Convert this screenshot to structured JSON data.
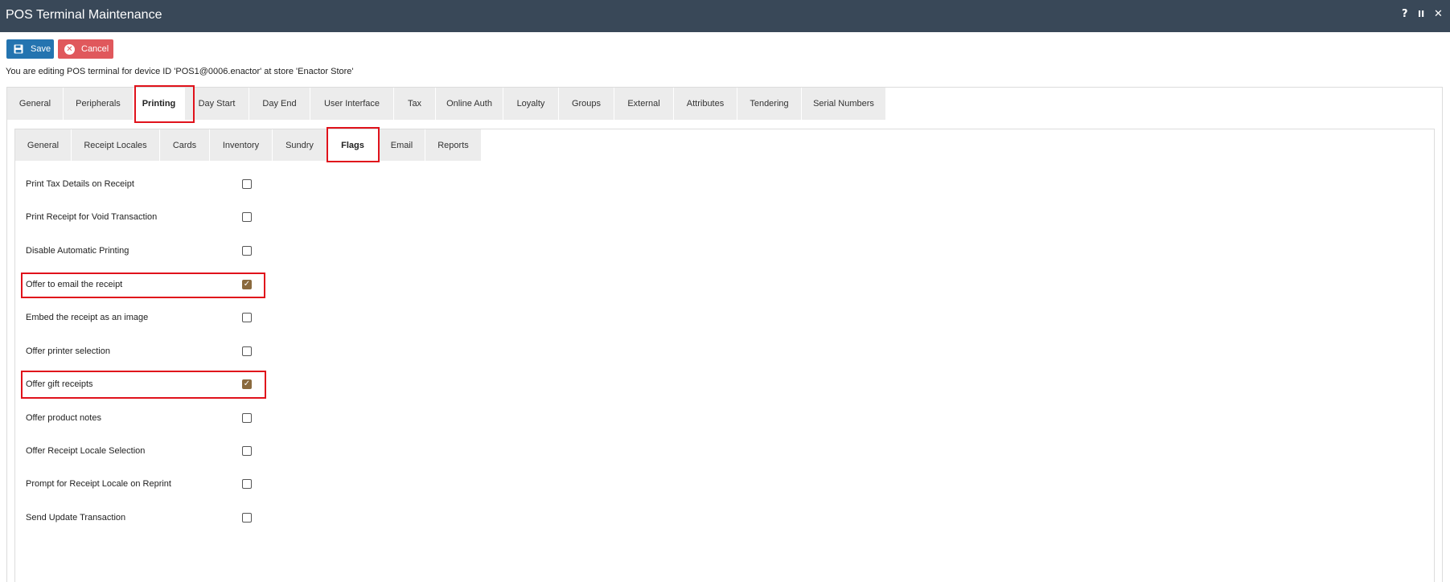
{
  "window": {
    "title": "POS Terminal Maintenance",
    "controls": {
      "help": "?",
      "pause": "II",
      "close": "✕"
    }
  },
  "toolbar": {
    "save_label": "Save",
    "cancel_label": "Cancel"
  },
  "info_text": "You are editing POS terminal for device ID 'POS1@0006.enactor' at store 'Enactor Store'",
  "main_tabs": [
    {
      "label": "General"
    },
    {
      "label": "Peripherals"
    },
    {
      "label": "Printing",
      "active": true
    },
    {
      "label": "Day Start"
    },
    {
      "label": "Day End"
    },
    {
      "label": "User Interface"
    },
    {
      "label": "Tax"
    },
    {
      "label": "Online Auth"
    },
    {
      "label": "Loyalty"
    },
    {
      "label": "Groups"
    },
    {
      "label": "External"
    },
    {
      "label": "Attributes"
    },
    {
      "label": "Tendering"
    },
    {
      "label": "Serial Numbers"
    }
  ],
  "sub_tabs": [
    {
      "label": "General"
    },
    {
      "label": "Receipt Locales"
    },
    {
      "label": "Cards"
    },
    {
      "label": "Inventory"
    },
    {
      "label": "Sundry"
    },
    {
      "label": "Flags",
      "active": true
    },
    {
      "label": "Email"
    },
    {
      "label": "Reports"
    }
  ],
  "flags": [
    {
      "label": "Print Tax Details on Receipt",
      "checked": false
    },
    {
      "label": "Print Receipt for Void Transaction",
      "checked": false
    },
    {
      "label": "Disable Automatic Printing",
      "checked": false
    },
    {
      "label": "Offer to email the receipt",
      "checked": true
    },
    {
      "label": "Embed the receipt as an image",
      "checked": false
    },
    {
      "label": "Offer printer selection",
      "checked": false
    },
    {
      "label": "Offer gift receipts",
      "checked": true
    },
    {
      "label": "Offer product notes",
      "checked": false
    },
    {
      "label": "Offer Receipt Locale Selection",
      "checked": false
    },
    {
      "label": "Prompt for Receipt Locale on Reprint",
      "checked": false
    },
    {
      "label": "Send Update Transaction",
      "checked": false
    }
  ],
  "colors": {
    "titlebar": "#394858",
    "save_button": "#2474b0",
    "cancel_button": "#e0585c",
    "highlight": "#e0121b",
    "checkbox_checked": "#8a6a3e"
  }
}
